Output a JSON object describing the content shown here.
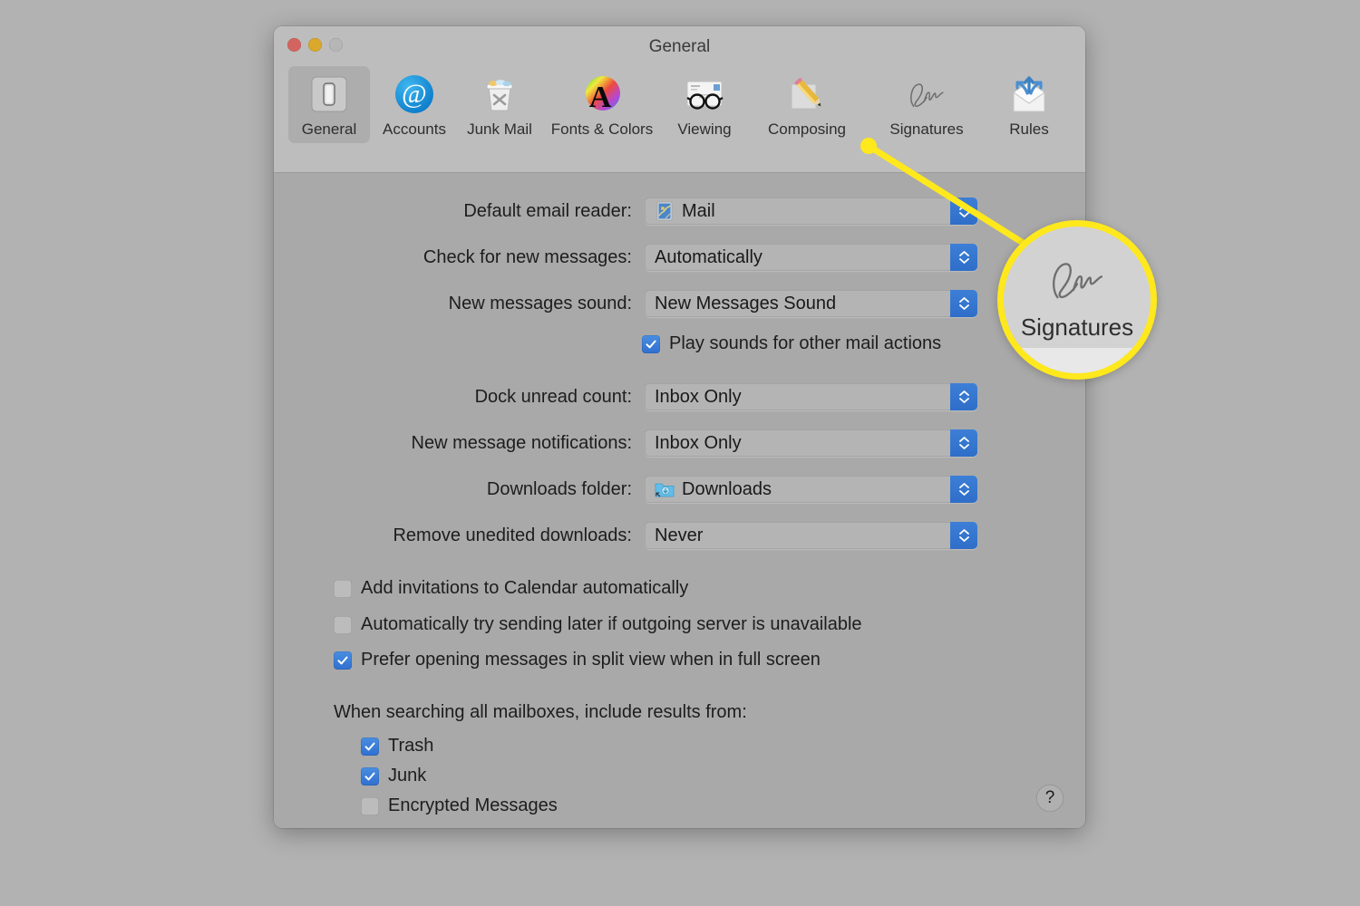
{
  "window": {
    "title": "General",
    "traffic_lights": [
      {
        "name": "close",
        "color": "#d4645f"
      },
      {
        "name": "minimize",
        "color": "#d9a82c"
      },
      {
        "name": "zoom",
        "color": "#b6b6b6"
      }
    ]
  },
  "toolbar": {
    "items": [
      {
        "label": "General",
        "icon": "general-switch-icon",
        "selected": true
      },
      {
        "label": "Accounts",
        "icon": "at-sign-icon",
        "selected": false
      },
      {
        "label": "Junk Mail",
        "icon": "trash-can-icon",
        "selected": false
      },
      {
        "label": "Fonts & Colors",
        "icon": "font-colors-icon",
        "selected": false
      },
      {
        "label": "Viewing",
        "icon": "glasses-letter-icon",
        "selected": false
      },
      {
        "label": "Composing",
        "icon": "pencil-paper-icon",
        "selected": false
      },
      {
        "label": "Signatures",
        "icon": "signature-icon",
        "selected": false
      },
      {
        "label": "Rules",
        "icon": "envelope-arrows-icon",
        "selected": false
      }
    ]
  },
  "settings": {
    "popups": [
      {
        "label": "Default email reader:",
        "value": "Mail",
        "icon": "mail-app-icon"
      },
      {
        "label": "Check for new messages:",
        "value": "Automatically",
        "icon": null
      },
      {
        "label": "New messages sound:",
        "value": "New Messages Sound",
        "icon": null
      },
      {
        "label": "Dock unread count:",
        "value": "Inbox Only",
        "icon": null
      },
      {
        "label": "New message notifications:",
        "value": "Inbox Only",
        "icon": null
      },
      {
        "label": "Downloads folder:",
        "value": "Downloads",
        "icon": "downloads-folder-icon"
      },
      {
        "label": "Remove unedited downloads:",
        "value": "Never",
        "icon": null
      }
    ],
    "sound_checkbox": {
      "label": "Play sounds for other mail actions",
      "checked": true
    },
    "option_checkboxes": [
      {
        "label": "Add invitations to Calendar automatically",
        "checked": false
      },
      {
        "label": "Automatically try sending later if outgoing server is unavailable",
        "checked": false
      },
      {
        "label": "Prefer opening messages in split view when in full screen",
        "checked": true
      }
    ],
    "search_section": {
      "label": "When searching all mailboxes, include results from:",
      "checkboxes": [
        {
          "label": "Trash",
          "checked": true
        },
        {
          "label": "Junk",
          "checked": true
        },
        {
          "label": "Encrypted Messages",
          "checked": false
        }
      ]
    },
    "help_button": {
      "label": "?"
    }
  },
  "callout": {
    "label": "Signatures",
    "icon": "signature-icon",
    "ring_color": "#ffe81c",
    "target": "Signatures"
  },
  "colors": {
    "page_background": "#b2b2b2",
    "window_background": "#a9a9a9",
    "toolbar_background": "#bdbdbd",
    "accent_blue": "#2f6fd0",
    "highlight_yellow": "#ffe81c"
  }
}
